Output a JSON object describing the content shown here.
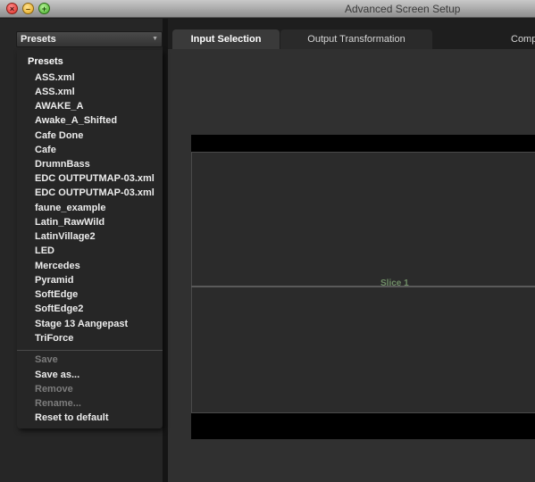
{
  "window": {
    "title": "Advanced Screen Setup"
  },
  "presets": {
    "dropdown_label": "Presets",
    "menu_header": "Presets",
    "items": [
      "ASS.xml",
      "ASS.xml",
      "AWAKE_A",
      "Awake_A_Shifted",
      "Cafe Done",
      "Cafe",
      "DrumnBass",
      "EDC OUTPUTMAP-03.xml",
      "EDC OUTPUTMAP-03.xml",
      "faune_example",
      "Latin_RawWild",
      "LatinVillage2",
      "LED",
      "Mercedes",
      "Pyramid",
      "SoftEdge",
      "SoftEdge2",
      "Stage 13 Aangepast",
      "TriForce"
    ],
    "actions": {
      "save": "Save",
      "save_as": "Save as...",
      "remove": "Remove",
      "rename": "Rename...",
      "reset": "Reset to default"
    }
  },
  "tabs": {
    "input_selection": "Input Selection",
    "output_transformation": "Output Transformation",
    "comp_cut": "Comp"
  },
  "canvas": {
    "slice_label": "Slice 1"
  }
}
